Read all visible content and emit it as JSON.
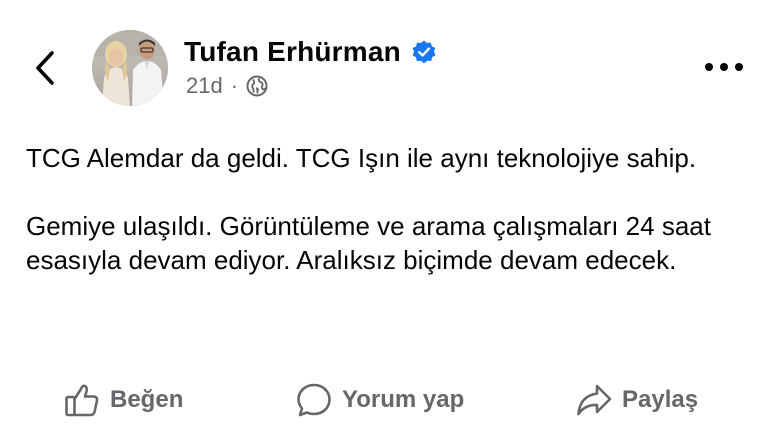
{
  "post": {
    "author": "Tufan Erhürman",
    "verified": true,
    "time": "21d",
    "separator": "·",
    "audience_icon": "globe-icon",
    "paragraphs": [
      "TCG Alemdar da geldi. TCG Işın ile aynı teknolojiye sahip.",
      "Gemiye ulaşıldı. Görüntüleme ve arama çalışmaları 24 saat esasıyla devam ediyor. Aralıksız biçimde devam edecek."
    ]
  },
  "actions": {
    "like": {
      "label": "Beğen",
      "icon": "thumbs-up-icon"
    },
    "comment": {
      "label": "Yorum yap",
      "icon": "comment-bubble-icon"
    },
    "share": {
      "label": "Paylaş",
      "icon": "share-arrow-icon"
    }
  },
  "header": {
    "back_icon": "chevron-left-icon",
    "more_icon": "more-dots-icon"
  },
  "colors": {
    "text": "#050505",
    "secondary": "#65676b",
    "verified_badge": "#1877f2"
  }
}
